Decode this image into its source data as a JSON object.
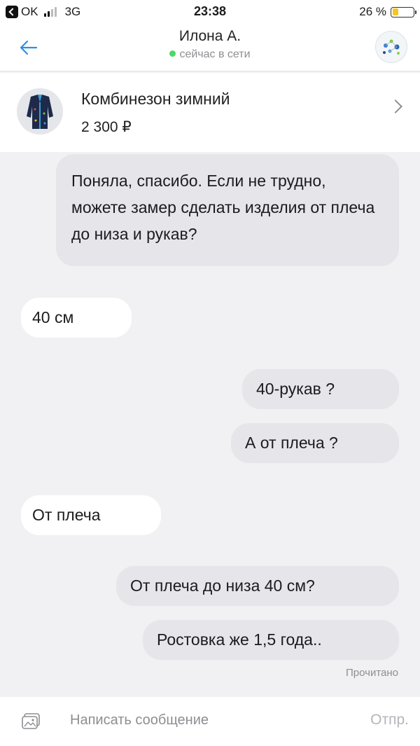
{
  "status_bar": {
    "carrier": "OK",
    "network": "3G",
    "time": "23:38",
    "battery": "26 %",
    "battery_level": 0.26
  },
  "header": {
    "back_icon": "arrow-left-icon",
    "contact_name": "Илона А.",
    "presence": "сейчас в сети",
    "presence_color": "#4cd964"
  },
  "product": {
    "title": "Комбинезон зимний",
    "price": "2 300 ₽"
  },
  "messages": [
    {
      "direction": "out",
      "text": "Поняла, спасибо. Если не трудно, можете замер сделать изделия от плеча до низа и рукав?"
    },
    {
      "direction": "in",
      "text": "40 см"
    },
    {
      "direction": "out",
      "text": "40-рукав ?"
    },
    {
      "direction": "out",
      "text": "А от плеча ?"
    },
    {
      "direction": "in",
      "text": "От плеча"
    },
    {
      "direction": "out",
      "text": "От плеча до низа 40 см?"
    },
    {
      "direction": "out",
      "text": "Ростовка же 1,5 года.."
    }
  ],
  "read_receipt": "Прочитано",
  "composer": {
    "placeholder": "Написать сообщение",
    "send_label": "Отпр."
  },
  "colors": {
    "accent": "#2f8fe0",
    "outgoing_bubble": "#e5e5ea",
    "incoming_bubble": "#ffffff",
    "background": "#f1f1f3"
  }
}
